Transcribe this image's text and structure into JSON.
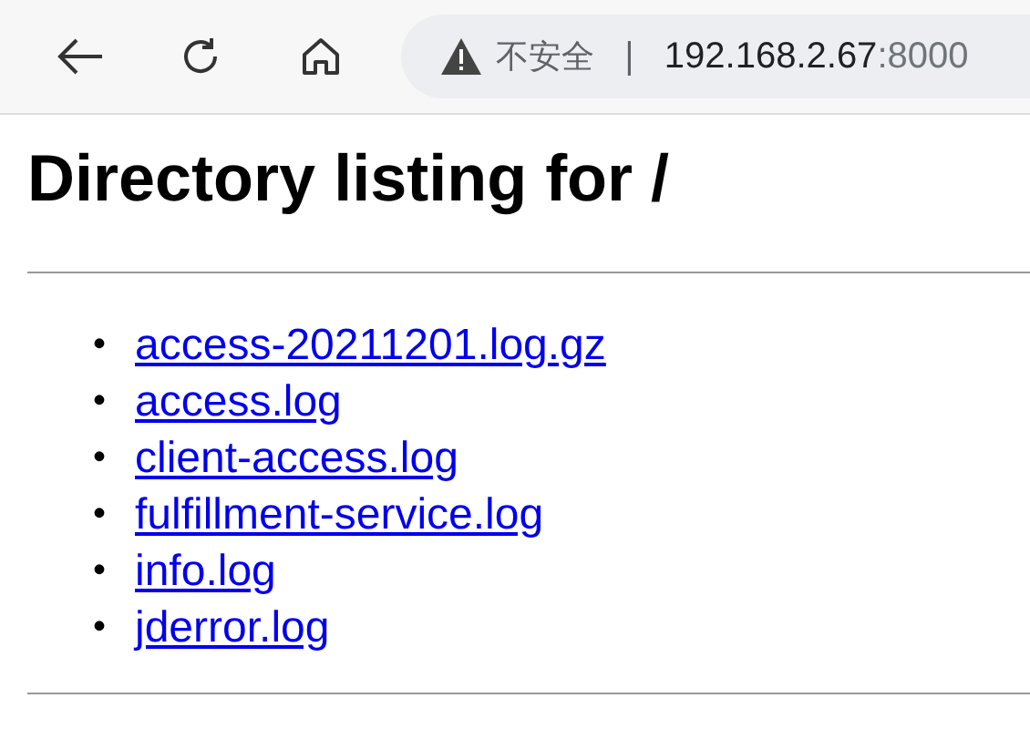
{
  "browser": {
    "security_label": "不安全",
    "separator": "|",
    "host": "192.168.2.67",
    "port": ":8000"
  },
  "page": {
    "heading": "Directory listing for /",
    "files": [
      {
        "marker": "•",
        "name": "access-20211201.log.gz"
      },
      {
        "marker": "•",
        "name": "access.log"
      },
      {
        "marker": "•",
        "name": "client-access.log"
      },
      {
        "marker": "•",
        "name": "fulfillment-service.log"
      },
      {
        "marker": "•",
        "name": "info.log"
      },
      {
        "marker": "•",
        "name": "jderror.log"
      }
    ]
  }
}
